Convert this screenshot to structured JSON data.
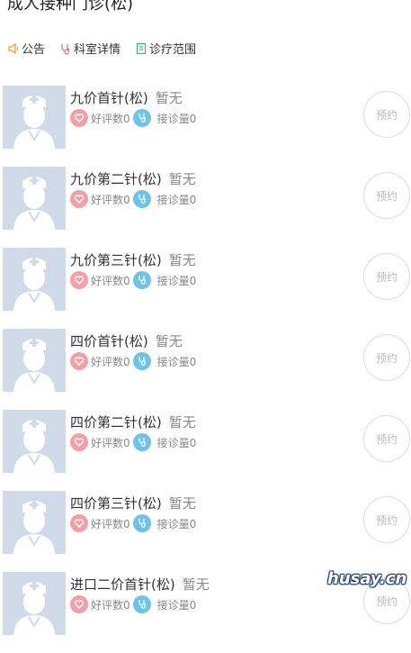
{
  "header": {
    "title": "成人接种门诊(松)"
  },
  "tabs": [
    {
      "label": "公告",
      "icon": "speaker-icon",
      "color": "#f0a020"
    },
    {
      "label": "科室详情",
      "icon": "stethoscope-icon",
      "color": "#e8707a"
    },
    {
      "label": "诊疗范围",
      "icon": "document-icon",
      "color": "#3cba7a"
    }
  ],
  "doctors": [
    {
      "name": "九价首针(松)",
      "status": "暂无",
      "rating_label": "好评数0",
      "visits_label": "接诊量0",
      "book_label": "预约"
    },
    {
      "name": "九价第二针(松)",
      "status": "暂无",
      "rating_label": "好评数0",
      "visits_label": "接诊量0",
      "book_label": "预约"
    },
    {
      "name": "九价第三针(松)",
      "status": "暂无",
      "rating_label": "好评数0",
      "visits_label": "接诊量0",
      "book_label": "预约"
    },
    {
      "name": "四价首针(松)",
      "status": "暂无",
      "rating_label": "好评数0",
      "visits_label": "接诊量0",
      "book_label": "预约"
    },
    {
      "name": "四价第二针(松)",
      "status": "暂无",
      "rating_label": "好评数0",
      "visits_label": "接诊量0",
      "book_label": "预约"
    },
    {
      "name": "四价第三针(松)",
      "status": "暂无",
      "rating_label": "好评数0",
      "visits_label": "接诊量0",
      "book_label": "预约"
    },
    {
      "name": "进口二价首针(松)",
      "status": "暂无",
      "rating_label": "好评数0",
      "visits_label": "接诊量0",
      "book_label": "预约"
    }
  ],
  "watermark": "husay.cn",
  "colors": {
    "avatar_bg": "#cfdbe8",
    "heart_badge": "#f2a0a6",
    "steth_badge": "#6ec3ea"
  }
}
